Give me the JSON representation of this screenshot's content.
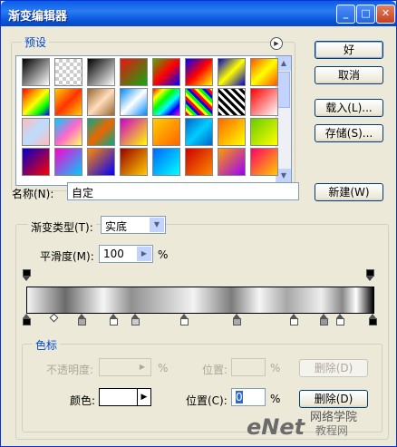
{
  "window": {
    "title": "渐变编辑器"
  },
  "title_buttons": {
    "minimize": "_",
    "maximize": "□",
    "close": "✕"
  },
  "presets": {
    "legend": "预设",
    "swatches": [
      [
        "linear-gradient(135deg,#000,#fff)",
        "repeating-conic-gradient(#ccc 0 25%,#fff 0 50%) 0 0/8px 8px",
        "linear-gradient(135deg,#000,#fff)",
        "linear-gradient(135deg,#e11,#1a1)",
        "linear-gradient(135deg,#5a0,#f00,#00f)",
        "linear-gradient(135deg,#00f,#f00,#ff0)",
        "linear-gradient(135deg,#00c,#ff0,#00c)",
        "linear-gradient(135deg,#f50,#ff0,#f50)"
      ],
      [
        "linear-gradient(135deg,#f00,#f80,#ff0,#0f0,#00f)",
        "linear-gradient(135deg,#fc0,#f30,#fc0)",
        "linear-gradient(135deg,#963,#fdb,#963)",
        "linear-gradient(135deg,#08f,#fff,#08f)",
        "linear-gradient(135deg,#f00,#ff0,#0f0,#0ff,#00f,#f0f)",
        "repeating-linear-gradient(45deg,#f00 0 3px,#ff0 3px 6px,#0f0 6px 9px,#00f 9px 12px)",
        "repeating-linear-gradient(45deg,#000 0 3px,#fff 3px 6px)",
        "linear-gradient(135deg,#f00,#fff)"
      ],
      [
        "linear-gradient(135deg,#fbb,#bdf,#fbb)",
        "linear-gradient(135deg,#0cf,#f6c,#ff6)",
        "linear-gradient(135deg,#0a8,#e60,#0a8)",
        "linear-gradient(135deg,#c0c,#ff0)",
        "linear-gradient(135deg,#fc0,#f60)",
        "linear-gradient(135deg,#06c,#0cf,#06c)",
        "linear-gradient(135deg,#f60,#ff0)",
        "linear-gradient(135deg,#6c0,#ff0)"
      ],
      [
        "linear-gradient(135deg,#00c,#f00)",
        "linear-gradient(135deg,#f0c,#0cf)",
        "linear-gradient(135deg,#f80,#00f)",
        "linear-gradient(135deg,#900,#fc0)",
        "linear-gradient(135deg,#06f,#0ff)",
        "linear-gradient(135deg,#c00,#f80)",
        "linear-gradient(135deg,#f90,#90f)",
        "linear-gradient(135deg,#f06,#fc0)"
      ]
    ]
  },
  "buttons": {
    "ok": "好",
    "cancel": "取消",
    "load": "载入(L)...",
    "save": "存储(S)...",
    "new": "新建(W)",
    "delete_disabled": "删除(D)",
    "delete": "删除(D)"
  },
  "name": {
    "label": "名称(N):",
    "value": "自定"
  },
  "type": {
    "label": "渐变类型(T):",
    "value": "实底"
  },
  "smoothness": {
    "label": "平滑度(M):",
    "value": "100",
    "unit": "%"
  },
  "stops": {
    "legend": "色标",
    "opacity_label": "不透明度:",
    "opacity_unit": "%",
    "opacity_location_label": "位置:",
    "opacity_location_unit": "%",
    "color_label": "颜色:",
    "location_label": "位置(C):",
    "location_value": "0",
    "location_unit": "%"
  },
  "watermark": {
    "text1": "eNet",
    "text2": "网络学院",
    "text3": "教程网"
  },
  "colors": {
    "titlebar": "#0a5de6",
    "accent": "#0046d5"
  }
}
